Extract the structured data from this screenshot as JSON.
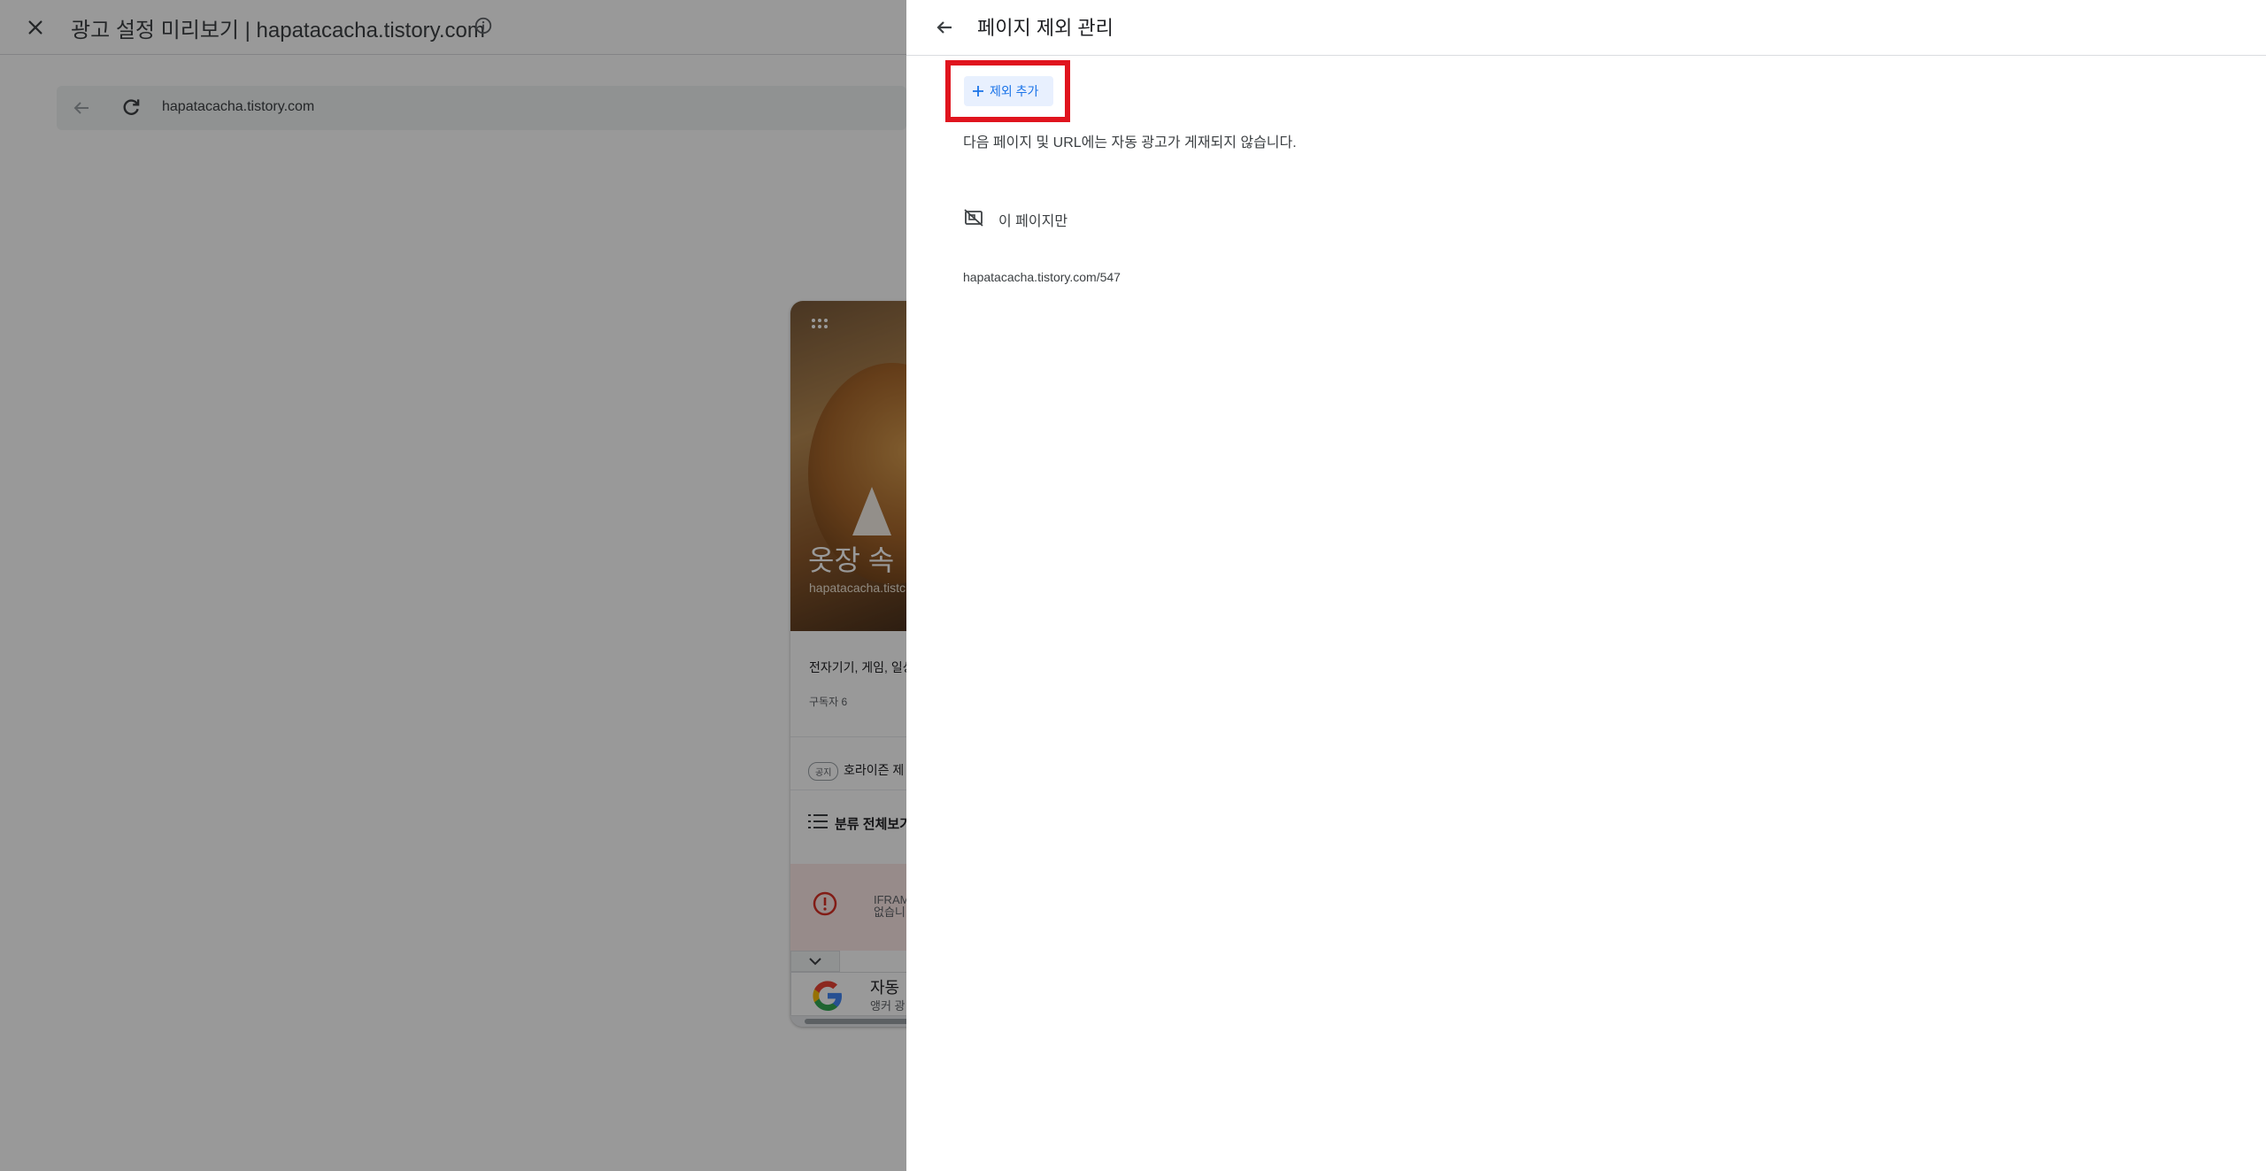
{
  "background": {
    "title": "광고 설정 미리보기 | hapatacacha.tistory.com",
    "url": "hapatacacha.tistory.com",
    "card": {
      "blog_title": "옷장 속 ",
      "blog_url": "hapatacacha.tistc",
      "categories": "전자기기, 게임, 일상",
      "subscribers": "구독자 6",
      "notice_tag": "공지",
      "notice": "호라이즌 제",
      "all_categories": "분류 전체보기",
      "error_line1": "IFRAM",
      "error_line2": "없습니",
      "ad_title": "자동",
      "ad_sub": "앵커 광"
    }
  },
  "panel": {
    "title": "페이지 제외 관리",
    "add_button": "제외 추가",
    "description": "다음 페이지 및 URL에는 자동 광고가 게재되지 않습니다.",
    "rule_scope": "이 페이지만",
    "rule_url": "hapatacacha.tistory.com/547"
  },
  "colors": {
    "highlight": "#e0141e",
    "accent": "#1a73e8",
    "accent_bg": "#e8f0fe"
  },
  "icons": {
    "close": "close-icon",
    "info": "info-icon",
    "back": "arrow-back-icon",
    "reload": "reload-icon",
    "add": "plus-icon",
    "rule": "ads-off-icon"
  }
}
